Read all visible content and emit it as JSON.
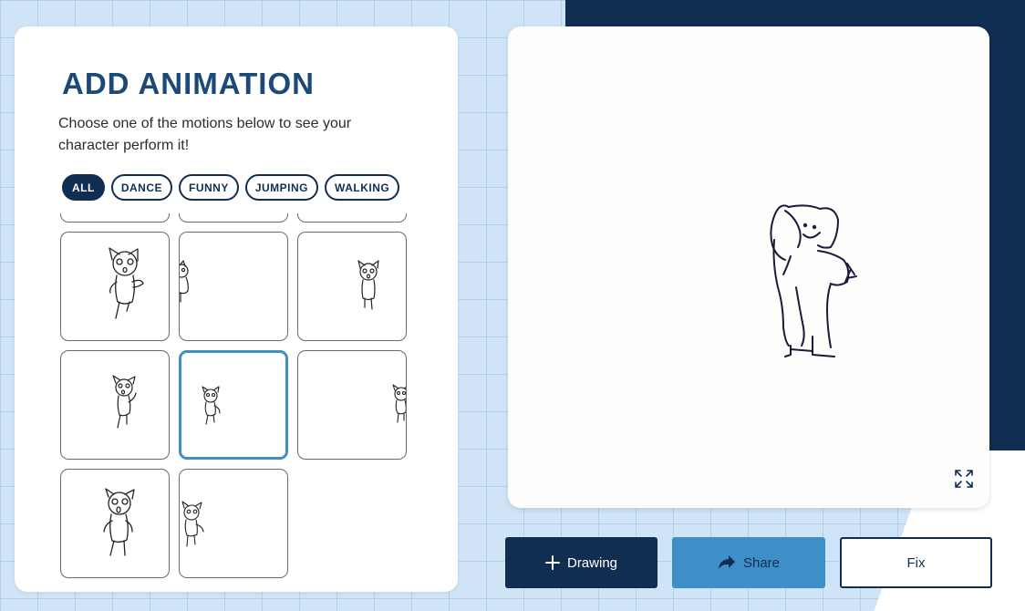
{
  "panel": {
    "title": "ADD ANIMATION",
    "description": "Choose one of the motions below to see your character perform it!"
  },
  "filters": [
    {
      "label": "ALL",
      "active": true
    },
    {
      "label": "DANCE",
      "active": false
    },
    {
      "label": "FUNNY",
      "active": false
    },
    {
      "label": "JUMPING",
      "active": false
    },
    {
      "label": "WALKING",
      "active": false
    }
  ],
  "motions": {
    "selected_tile": 7,
    "visible_tiles": 11
  },
  "actions": {
    "drawing_label": "Drawing",
    "share_label": "Share",
    "fix_label": "Fix"
  },
  "icons": {
    "drawing": "plus-icon",
    "share": "share-arrow-icon",
    "preview": "fullscreen-icon"
  },
  "colors": {
    "navy": "#102d52",
    "accent_blue": "#3e8fc8",
    "title_blue": "#1b4a78",
    "background": "#cfe5f7"
  }
}
